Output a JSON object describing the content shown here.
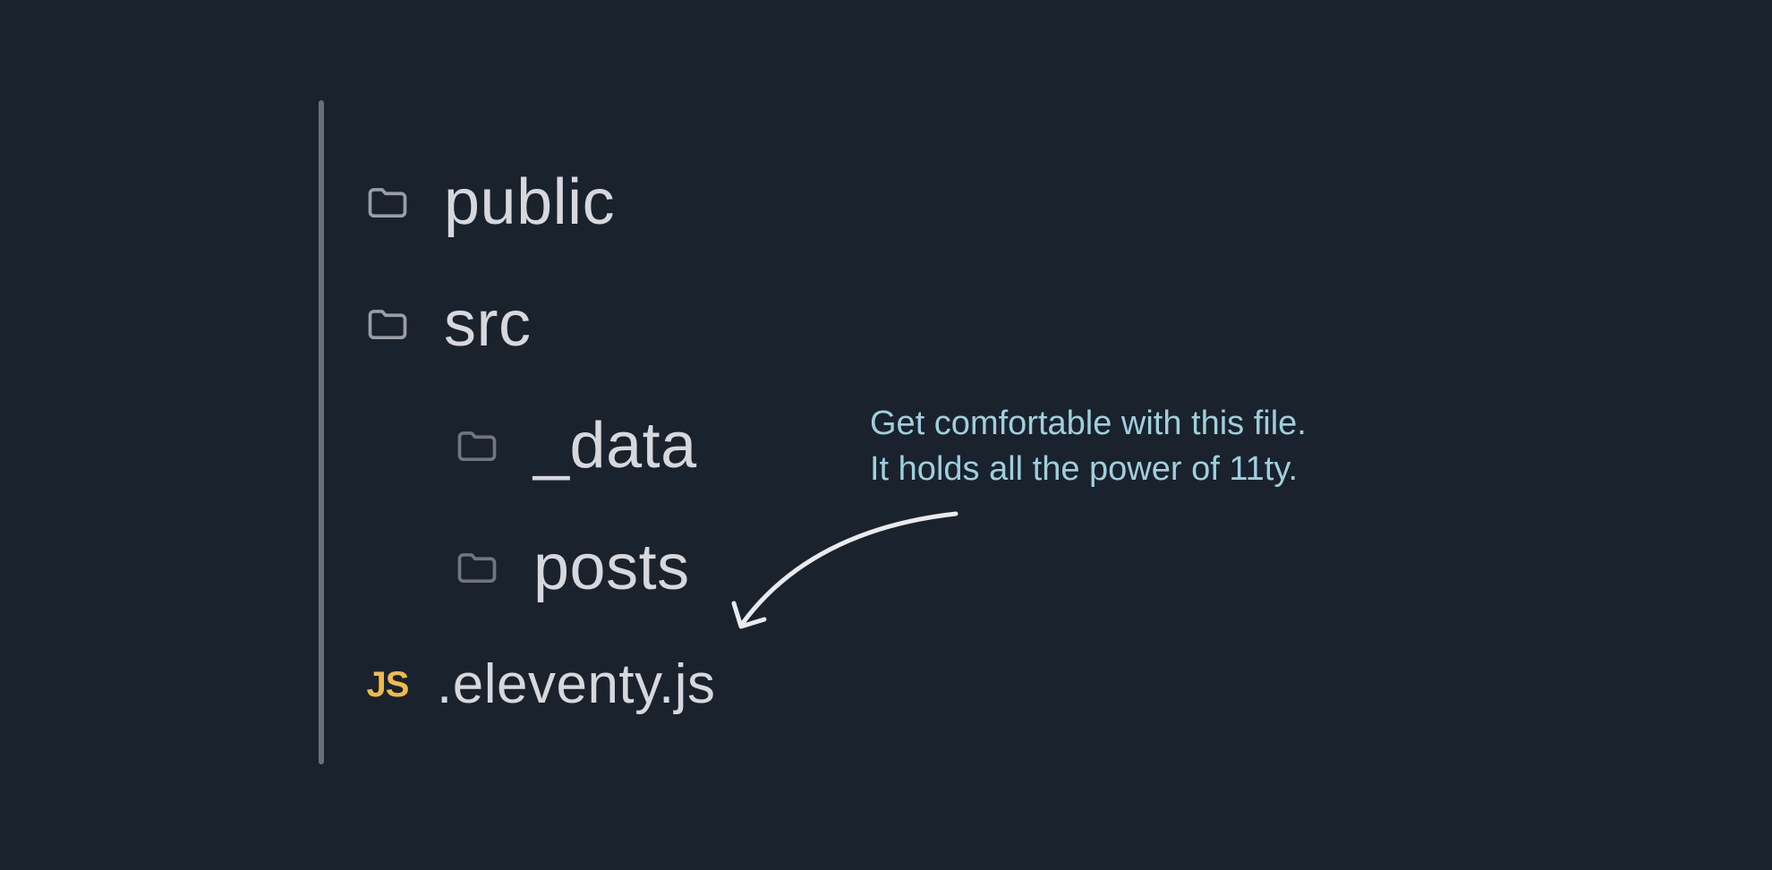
{
  "tree": {
    "items": [
      {
        "type": "folder",
        "label": "public",
        "indent": false
      },
      {
        "type": "folder",
        "label": "src",
        "indent": false
      },
      {
        "type": "folder",
        "label": "_data",
        "indent": true
      },
      {
        "type": "folder",
        "label": "posts",
        "indent": true
      },
      {
        "type": "file-js",
        "label": ".eleventy.js",
        "indent": false,
        "icon_text": "JS"
      }
    ]
  },
  "annotation": {
    "line1": "Get comfortable with this file.",
    "line2": "It holds all the power of 11ty."
  },
  "colors": {
    "background": "#1a222d",
    "rule": "#6b7078",
    "text": "#d6d8de",
    "annotation": "#9fcfdd",
    "js_icon": "#f0b94a"
  }
}
